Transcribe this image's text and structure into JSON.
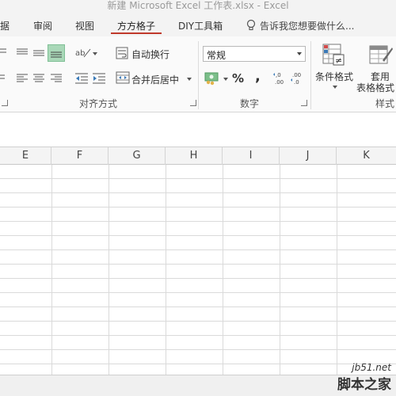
{
  "window": {
    "title": "新建 Microsoft Excel 工作表.xlsx - Excel"
  },
  "tabs": [
    {
      "label": "据"
    },
    {
      "label": "审阅"
    },
    {
      "label": "视图"
    },
    {
      "label": "方方格子",
      "active": true
    },
    {
      "label": "DIY工具箱"
    }
  ],
  "tell_me": {
    "text": "告诉我您想要做什么..."
  },
  "ribbon": {
    "alignment": {
      "label": "对齐方式",
      "wrap_text": "自动换行",
      "merge_center": "合并后居中"
    },
    "number": {
      "label": "数字",
      "format_value": "常规",
      "percent_symbol": "%",
      "comma_symbol": ",",
      "increase_decimal": "←0\n.00",
      "decrease_decimal": ".00\n→.0"
    },
    "styles": {
      "label": "样式",
      "conditional_format": "条件格式",
      "table_format_line1": "套用",
      "table_format_line2": "表格格式"
    }
  },
  "columns": [
    "E",
    "F",
    "G",
    "H",
    "I",
    "J",
    "K"
  ],
  "watermark": {
    "url": "jb51.net",
    "name": "脚本之家"
  },
  "colors": {
    "accent_tab_underline": "#c0392b",
    "ribbon_bg": "#fafafa",
    "grid_line": "#dadada"
  }
}
